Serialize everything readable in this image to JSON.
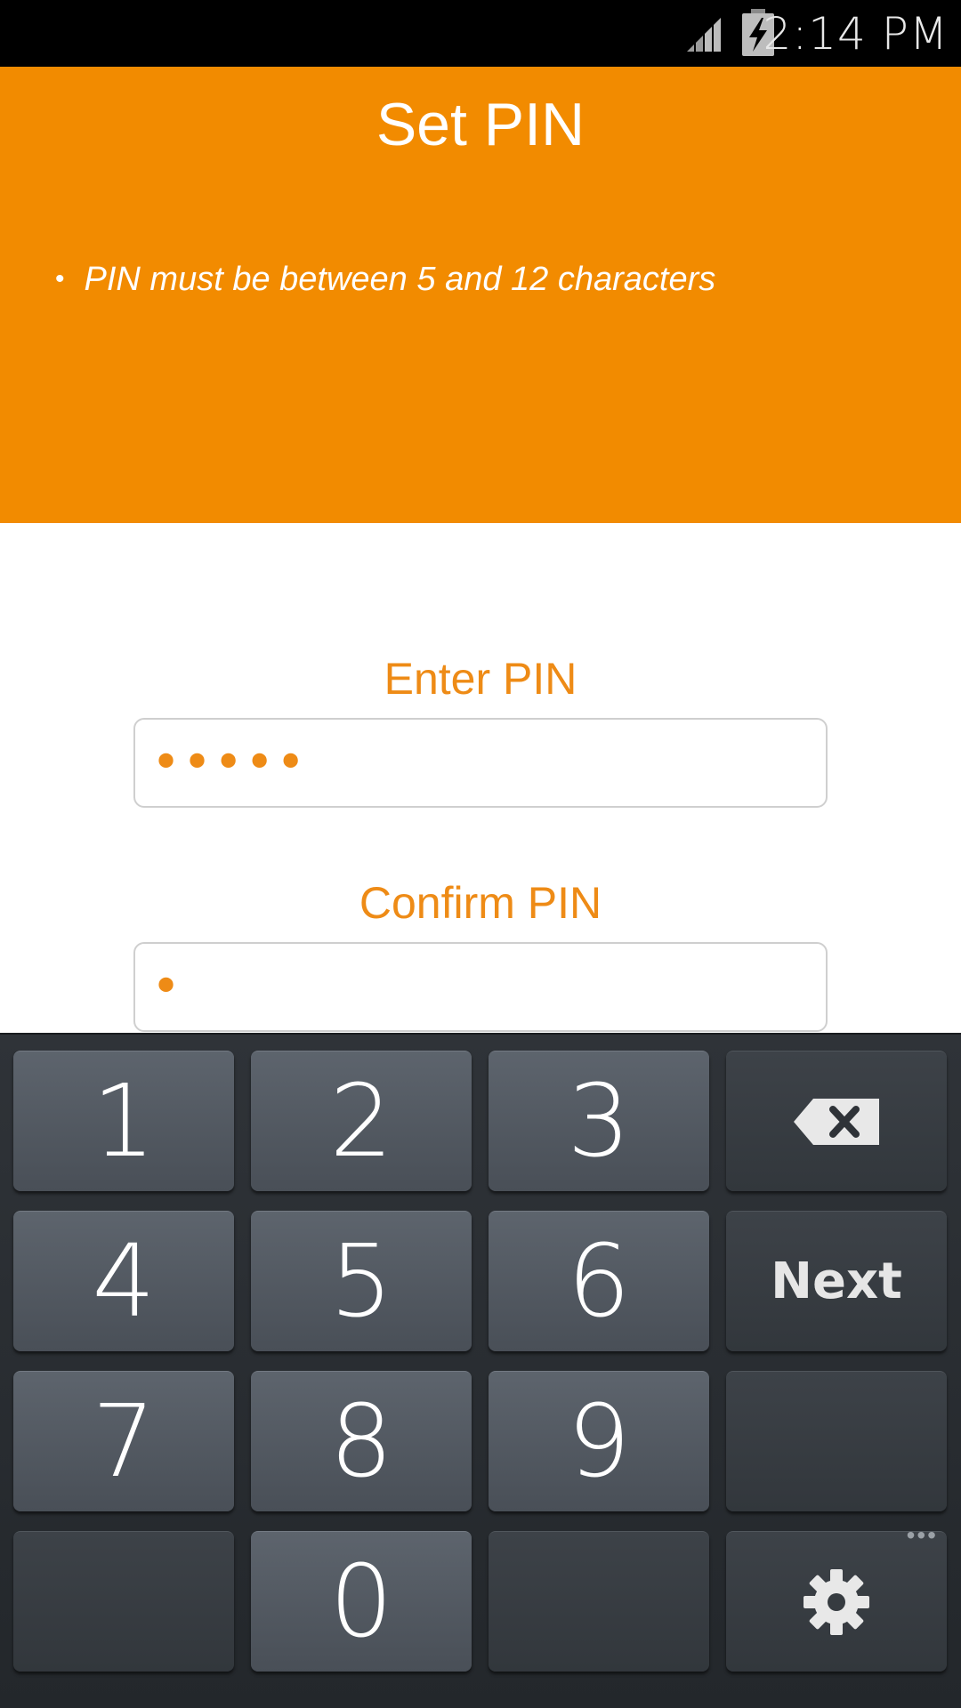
{
  "status_bar": {
    "time": "2:14 PM",
    "signal_icon": "signal-icon",
    "battery_icon": "battery-charging-icon"
  },
  "header": {
    "title": "Set PIN",
    "bullet": "•",
    "rule": "PIN must be between 5 and 12 characters",
    "background_color": "#f28b00"
  },
  "form": {
    "enter_label": "Enter PIN",
    "enter_value": "•••••",
    "confirm_label": "Confirm PIN",
    "confirm_value": "•",
    "accent_color": "#ee8b16"
  },
  "keypad": {
    "digits": [
      "1",
      "2",
      "3",
      "4",
      "5",
      "6",
      "7",
      "8",
      "9",
      "0"
    ],
    "next_label": "Next",
    "backspace_icon": "backspace-icon",
    "settings_icon": "gear-icon",
    "more_indicator": "•••"
  }
}
